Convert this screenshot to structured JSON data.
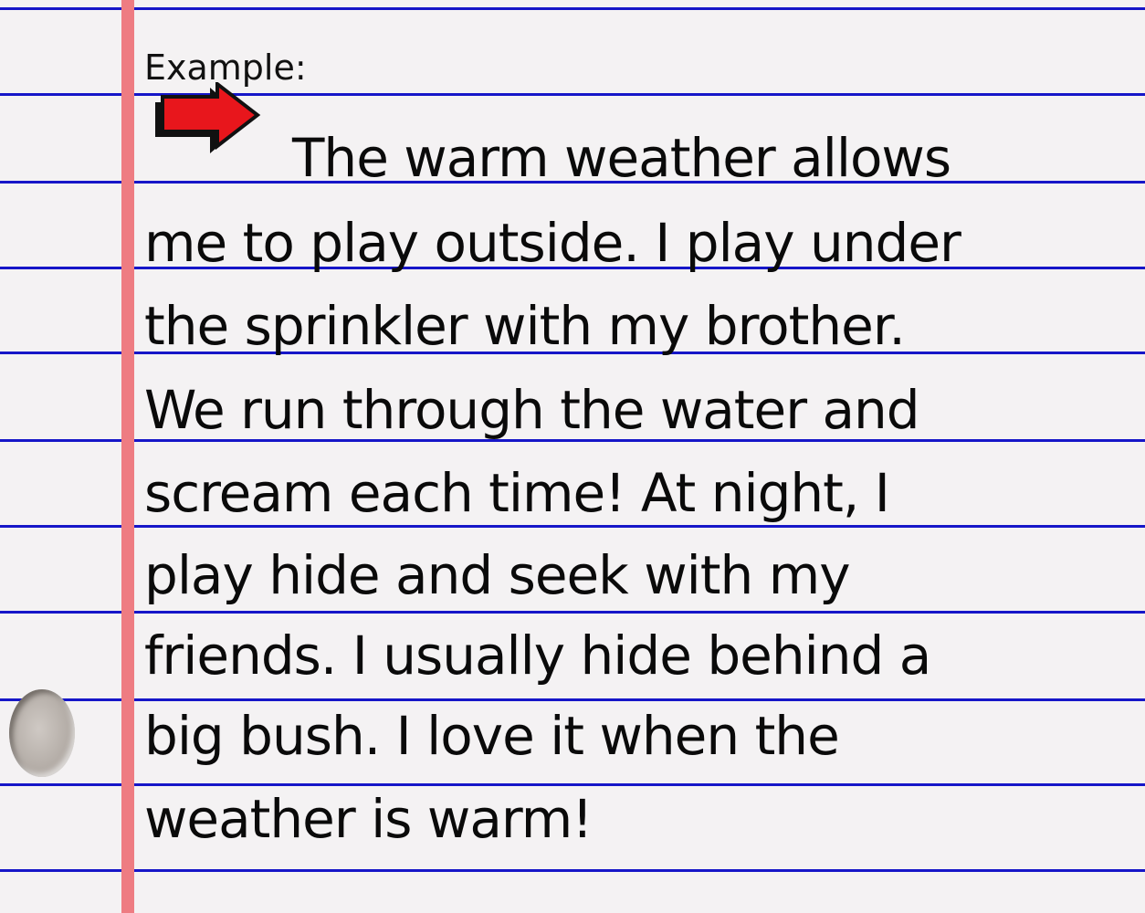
{
  "example_label": "Example:",
  "paragraph_lines": [
    "The warm weather allows",
    "me to play outside.  I play under",
    "the sprinkler with my brother.",
    "We run through the water and",
    "scream each time!  At night, I",
    "play hide and seek with my",
    "friends.  I usually hide behind a",
    "big bush.  I love it when the",
    "weather is warm!"
  ],
  "colors": {
    "paper": "#f4f2f3",
    "rule_lines": "#1616c8",
    "margin_line": "#ee7c82",
    "arrow_fill": "#e8161c",
    "text": "#0a0a0a"
  },
  "icons": {
    "indent_arrow": "right-arrow-icon",
    "binder_hole": "punch-hole"
  }
}
